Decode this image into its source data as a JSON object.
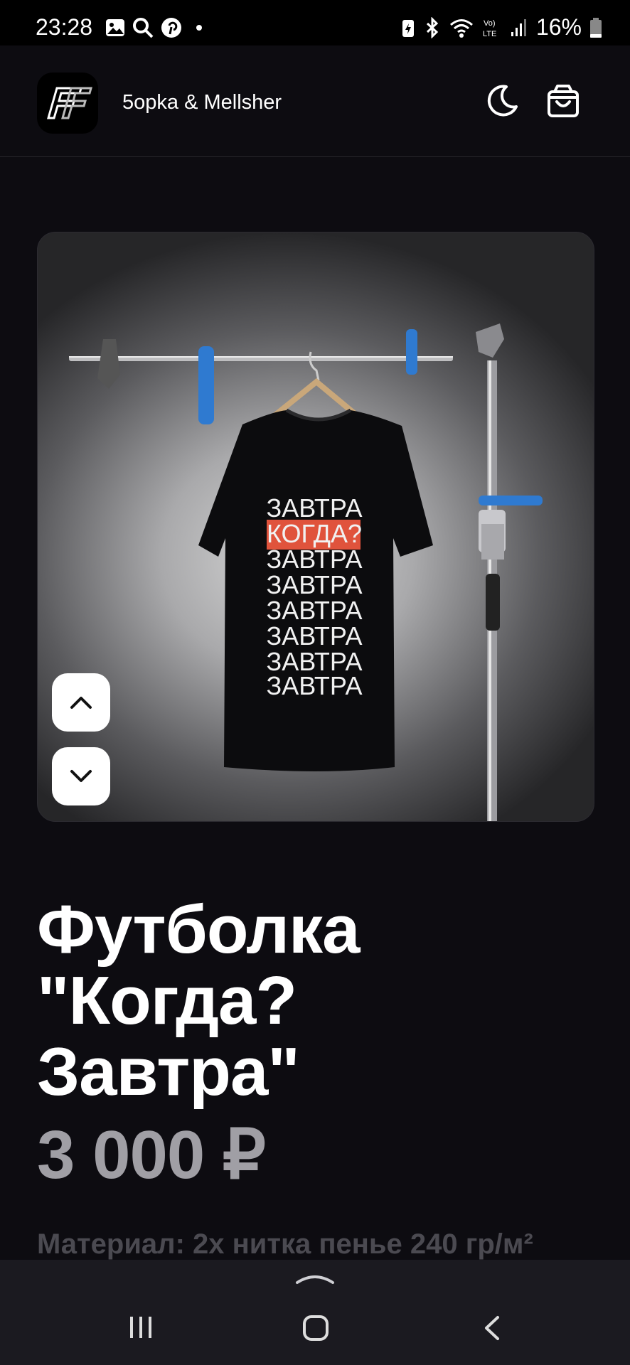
{
  "status": {
    "time": "23:28",
    "battery": "16%"
  },
  "header": {
    "brand": "5opka & Mellsher",
    "logo_text": "FF"
  },
  "product": {
    "shirt_lines": [
      "ЗАВТРА",
      "КОГДА?",
      "ЗАВТРА",
      "ЗАВТРА",
      "ЗАВТРА",
      "ЗАВТРА",
      "ЗАВТРА",
      "ЗАВТРА"
    ],
    "title_line1": "Футболка",
    "title_line2": "\"Когда?",
    "title_line3": "Завтра\"",
    "price": "3 000 ₽",
    "material": "Материал: 2х нитка пенье 240 гр/м²"
  },
  "icons": {
    "moon": "moon-icon",
    "cart": "shopping-bag-icon",
    "up": "chevron-up-icon",
    "down": "chevron-down-icon"
  },
  "colors": {
    "background": "#0d0c11",
    "price": "#a09fa5",
    "accent_red": "#e0533c",
    "clip_blue": "#2f7ad0"
  }
}
